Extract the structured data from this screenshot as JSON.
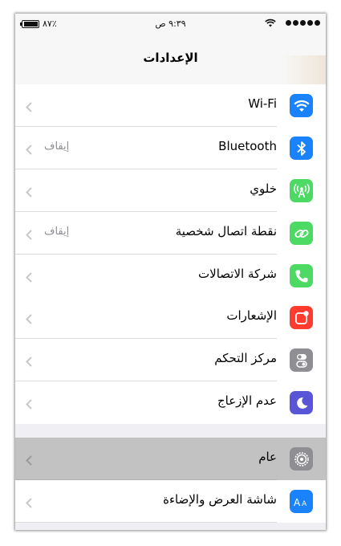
{
  "status_bar": {
    "battery_percent": "٨٧٪",
    "time": "٩:٣٩ ص"
  },
  "header": {
    "title": "الإعدادات"
  },
  "sections": [
    {
      "items": [
        {
          "label": "Wi-Fi",
          "value": "",
          "icon": "wifi-icon",
          "color": "#1a82fb"
        },
        {
          "label": "Bluetooth",
          "value": "إيقاف",
          "icon": "bluetooth-icon",
          "color": "#1a82fb"
        },
        {
          "label": "خلوي",
          "value": "",
          "icon": "cellular-icon",
          "color": "#4cd964"
        },
        {
          "label": "نقطة اتصال شخصية",
          "value": "إيقاف",
          "icon": "hotspot-icon",
          "color": "#4cd964"
        },
        {
          "label": "شركة الاتصالات",
          "value": "",
          "icon": "phone-icon",
          "color": "#4cd964"
        }
      ]
    },
    {
      "items": [
        {
          "label": "الإشعارات",
          "value": "",
          "icon": "notifications-icon",
          "color": "#ff3b30"
        },
        {
          "label": "مركز التحكم",
          "value": "",
          "icon": "control-center-icon",
          "color": "#8e8e93"
        },
        {
          "label": "عدم الإزعاج",
          "value": "",
          "icon": "moon-icon",
          "color": "#5856d6"
        }
      ]
    },
    {
      "items": [
        {
          "label": "عام",
          "value": "",
          "icon": "gear-icon",
          "color": "#8e8e93",
          "highlighted": true
        },
        {
          "label": "شاشة العرض والإضاءة",
          "value": "",
          "icon": "display-brightness-icon",
          "color": "#1a82fb"
        }
      ]
    }
  ]
}
